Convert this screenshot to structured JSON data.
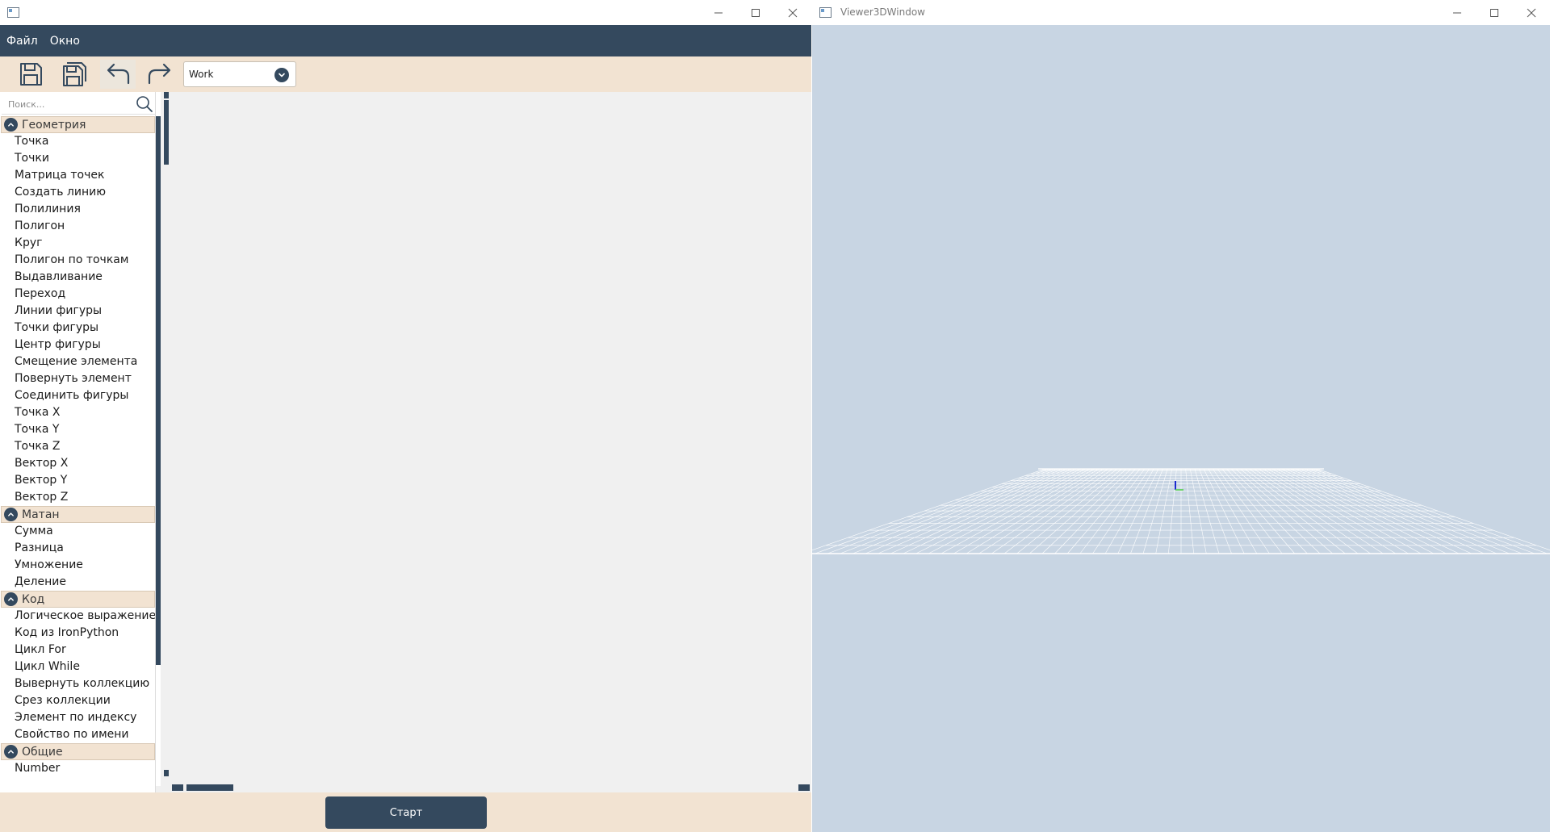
{
  "left_window": {
    "menu": [
      "Файл",
      "Окно"
    ],
    "toolbar": {
      "combo_value": "Work"
    },
    "search": {
      "placeholder": "Поиск..."
    },
    "categories": [
      {
        "label": "Геометрия",
        "items": [
          "Точка",
          "Точки",
          "Матрица точек",
          "Создать линию",
          "Полилиния",
          "Полигон",
          "Круг",
          "Полигон по точкам",
          "Выдавливание",
          "Переход",
          "Линии фигуры",
          "Точки фигуры",
          "Центр фигуры",
          "Смещение элемента",
          "Повернуть элемент",
          "Соединить фигуры",
          "Точка X",
          "Точка Y",
          "Точка Z",
          "Вектор X",
          "Вектор Y",
          "Вектор Z"
        ]
      },
      {
        "label": "Матан",
        "items": [
          "Сумма",
          "Разница",
          "Умножение",
          "Деление"
        ]
      },
      {
        "label": "Код",
        "items": [
          "Логическое выражение",
          "Код из IronPython",
          "Цикл For",
          "Цикл While",
          "Вывернуть коллекцию",
          "Срез коллекции",
          "Элемент по индексу",
          "Свойство по имени"
        ]
      },
      {
        "label": "Общие",
        "items": [
          "Number"
        ]
      }
    ],
    "footer": {
      "start_label": "Старт"
    }
  },
  "right_window": {
    "title": "Viewer3DWindow"
  },
  "colors": {
    "accent_dark": "#34495e",
    "toolbar_bg": "#f2e3d2",
    "canvas_bg": "#f0f0f0",
    "viewport_bg": "#c8d5e3",
    "grid_line": "#ffffff"
  },
  "icons": {
    "save": "save-icon",
    "save_as": "save-as-icon",
    "undo": "undo-icon",
    "redo": "redo-icon",
    "search": "search-icon",
    "collapse": "chevron-up-icon",
    "dropdown": "chevron-down-icon"
  }
}
